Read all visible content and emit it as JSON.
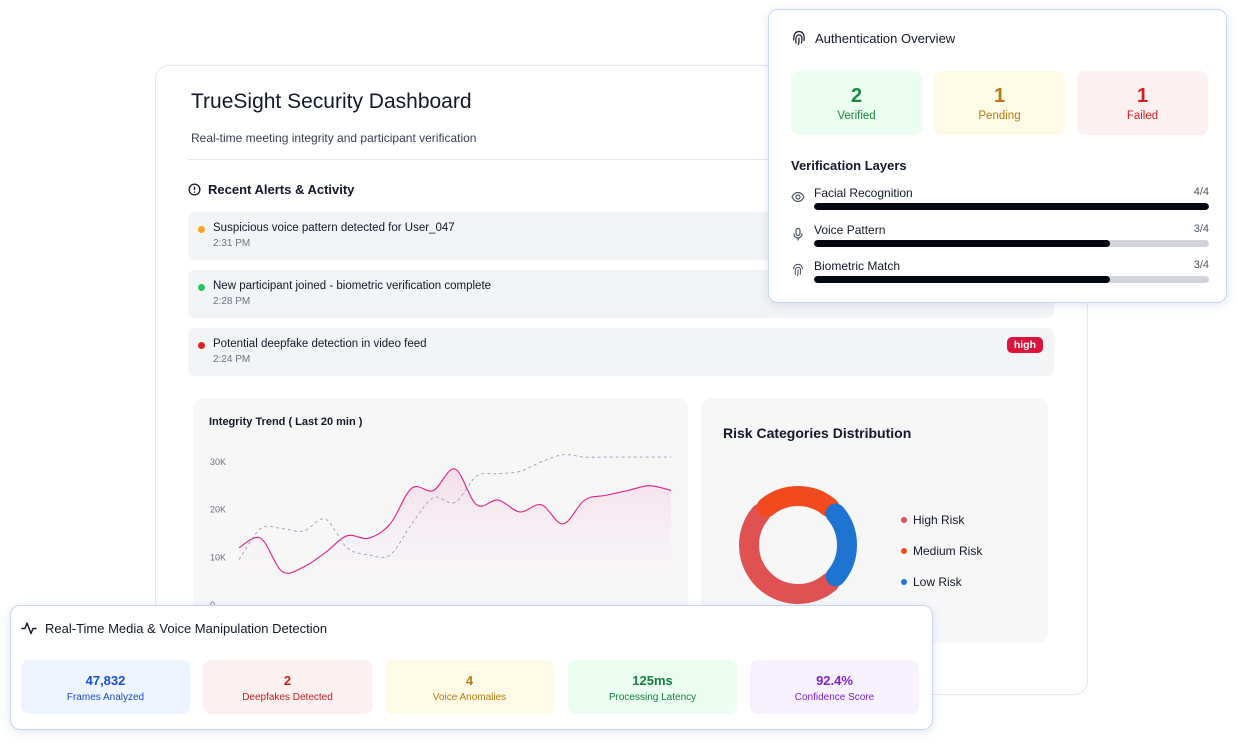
{
  "main": {
    "title": "TrueSight Security Dashboard",
    "subtitle": "Real-time meeting integrity and participant verification",
    "alerts_title": "Recent Alerts & Activity",
    "alerts": [
      {
        "message": "Suspicious voice pattern detected for User_047",
        "time": "2:31 PM",
        "color": "#f5a623",
        "badge": ""
      },
      {
        "message": "New participant joined - biometric verification complete",
        "time": "2:28 PM",
        "color": "#22c55e",
        "badge": ""
      },
      {
        "message": "Potential deepfake detection in video feed",
        "time": "2:24 PM",
        "color": "#dc2626",
        "badge": "high"
      }
    ]
  },
  "chart_data": [
    {
      "type": "line",
      "title": "Integrity Trend ( Last 20 min )",
      "ytick_labels": [
        "30K",
        "20K",
        "10K",
        "0"
      ],
      "ylim": [
        0,
        35000
      ],
      "series": [
        {
          "color": "#e0218a",
          "style": "solid",
          "x": [
            0,
            1,
            2,
            3,
            4,
            5,
            6,
            7,
            8,
            9,
            10,
            11,
            12,
            13,
            14,
            15,
            16,
            17,
            18,
            19,
            20
          ],
          "values": [
            12000,
            14000,
            7000,
            8000,
            11000,
            14500,
            14000,
            17000,
            24500,
            24000,
            28500,
            21000,
            22000,
            19500,
            21000,
            17000,
            22000,
            23000,
            24000,
            25000,
            24000
          ]
        },
        {
          "color": "#94a3b8",
          "style": "dashed",
          "x": [
            0,
            1,
            2,
            3,
            4,
            5,
            6,
            7,
            8,
            9,
            10,
            11,
            12,
            13,
            14,
            15,
            16,
            17,
            18,
            19,
            20
          ],
          "values": [
            9500,
            16000,
            16000,
            15500,
            18000,
            12000,
            10500,
            10500,
            17000,
            22500,
            21500,
            27000,
            27500,
            28000,
            30000,
            31500,
            31000,
            31000,
            31000,
            31000,
            31000
          ]
        }
      ]
    },
    {
      "type": "pie",
      "title": "Risk Categories Distribution",
      "series": [
        {
          "name": "High Risk",
          "value": 50,
          "color": "#e05252"
        },
        {
          "name": "Medium Risk",
          "value": 25,
          "color": "#f04a1e"
        },
        {
          "name": "Low Risk",
          "value": 25,
          "color": "#1f74d2"
        }
      ]
    }
  ],
  "auth": {
    "title": "Authentication Overview",
    "stats": [
      {
        "value": "2",
        "label": "Verified",
        "bg": "#ecfdf1",
        "color": "#1a8a3f"
      },
      {
        "value": "1",
        "label": "Pending",
        "bg": "#fdfae6",
        "color": "#b57b12"
      },
      {
        "value": "1",
        "label": "Failed",
        "bg": "#fdf0f0",
        "color": "#cf2020"
      }
    ],
    "layers_title": "Verification Layers",
    "layers": [
      {
        "name": "Facial Recognition",
        "value": "4/4",
        "fraction": 1.0,
        "icon": "eye-icon"
      },
      {
        "name": "Voice Pattern",
        "value": "3/4",
        "fraction": 0.75,
        "icon": "microphone-icon"
      },
      {
        "name": "Biometric Match",
        "value": "3/4",
        "fraction": 0.75,
        "icon": "fingerprint-icon"
      }
    ]
  },
  "media": {
    "title": "Real-Time Media & Voice Manipulation Detection",
    "metrics": [
      {
        "value": "47,832",
        "label": "Frames Analyzed",
        "bg": "#eef5ff",
        "color": "#1d4ed8"
      },
      {
        "value": "2",
        "label": "Deepfakes Detected",
        "bg": "#fdf0f0",
        "color": "#c81e1e"
      },
      {
        "value": "4",
        "label": "Voice Anomalies",
        "bg": "#fdfae6",
        "color": "#b57b12"
      },
      {
        "value": "125ms",
        "label": "Processing Latency",
        "bg": "#ecfdf1",
        "color": "#15803d"
      },
      {
        "value": "92.4%",
        "label": "Confidence Score",
        "bg": "#f8f2ff",
        "color": "#7e22ce"
      }
    ]
  }
}
